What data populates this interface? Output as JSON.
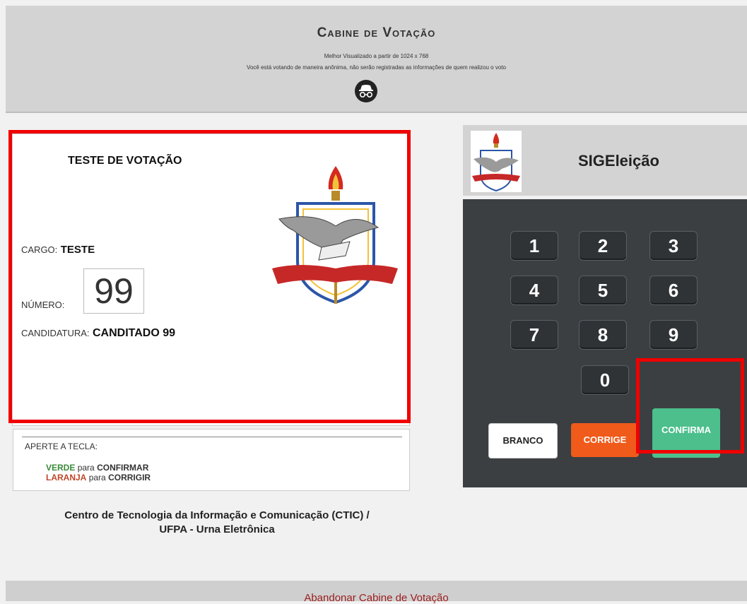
{
  "header": {
    "title": "Cabine de Votação",
    "subtitle1": "Melhor Visualizado a partir de 1024 x 768",
    "subtitle2": "Você está votando de maneira anônima, não serão registradas as informações de quem realizou o voto",
    "icon": "incognito-icon"
  },
  "ballot": {
    "title": "TESTE DE VOTAÇÃO",
    "cargo_label": "CARGO:",
    "cargo_value": "TESTE",
    "numero_label": "NÚMERO:",
    "numero_value": "99",
    "candidatura_label": "CANDIDATURA:",
    "candidatura_value": "CANDITADO 99",
    "emblem": "ufpa-emblem"
  },
  "instructions": {
    "heading": "APERTE A TECLA:",
    "green_key": "VERDE",
    "green_text": "para",
    "green_action": "CONFIRMAR",
    "orange_key": "LARANJA",
    "orange_text": "para",
    "orange_action": "CORRIGIR"
  },
  "footer_text": {
    "line1": "Centro de Tecnologia da Informação e Comunicação (CTIC) /",
    "line2": "UFPA - Urna Eletrônica"
  },
  "panel": {
    "title": "SIGEleição",
    "keys": [
      "1",
      "2",
      "3",
      "4",
      "5",
      "6",
      "7",
      "8",
      "9",
      "0"
    ],
    "branco": "BRANCO",
    "corrige": "CORRIGE",
    "confirma": "CONFIRMA"
  },
  "bottom": {
    "link": "Abandonar Cabine de Votação"
  },
  "colors": {
    "highlight": "#f00000",
    "confirm": "#4cbf8c",
    "correct": "#f05a1a",
    "keypad_bg": "#3b3f42"
  }
}
